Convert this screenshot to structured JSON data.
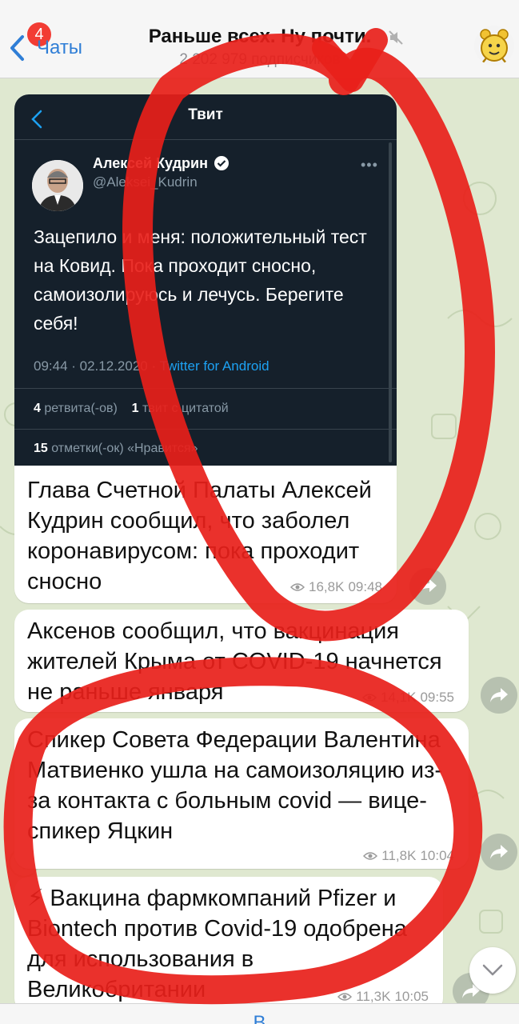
{
  "header": {
    "back_label": "Чаты",
    "unread_count": "4",
    "title": "Раньше всех. Ну почти.",
    "subtitle": "2 202 979 подписчиков"
  },
  "messages": [
    {
      "tweet": {
        "screen_title": "Твит",
        "author_name": "Алексей Кудрин",
        "author_handle": "@Aleksei_Kudrin",
        "text": "Зацепило и меня: положительный тест на Ковид. Пока проходит сносно, самоизолируюсь и лечусь. Берегите себя!",
        "time": "09:44 · 02.12.2020 ·",
        "source": "Twitter for Android",
        "retweets_count": "4",
        "retweets_label": "ретвита(-ов)",
        "quotes_count": "1",
        "quotes_label": "твит с цитатой",
        "likes_count": "15",
        "likes_label": "отметки(-ок) «Нравится»"
      },
      "text": "Глава Счетной Палаты Алексей Кудрин сообщил, что заболел коронавирусом: пока проходит сносно",
      "views": "16,8K",
      "time": "09:48"
    },
    {
      "text": "Аксенов сообщил, что вакцинация жителей Крыма от COVID-19 начнется не раньше января",
      "views": "14,1K",
      "time": "09:55"
    },
    {
      "text": "Спикер Совета Федерации Валентина Матвиенко ушла на самоизоляцию из-за контакта с больным covid — вице-спикер Яцкин",
      "views": "11,8K",
      "time": "10:04"
    },
    {
      "text": "⚡ Вакцина фармкомпаний Pfizer и Biontech против Covid-19 одобрена для использования в Великобритании",
      "views": "11,3K",
      "time": "10:05"
    }
  ],
  "bottom_bar": {
    "label": "В"
  },
  "colors": {
    "accent": "#2f7ed6",
    "badge": "#f23c34",
    "tweet_bg": "#15202b",
    "twitter_blue": "#1da1f2",
    "annotation": "#e8201a",
    "wallpaper": "#dfe8d0"
  }
}
